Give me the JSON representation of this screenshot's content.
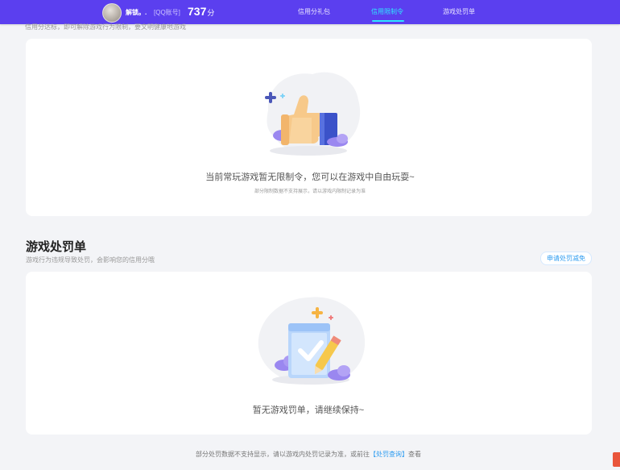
{
  "header": {
    "user_name": "解锁。.",
    "qq_label": "[QQ账号]",
    "score_value": "737",
    "score_unit": "分",
    "tabs": [
      {
        "label": "信用分礼包",
        "active": false
      },
      {
        "label": "信用限制令",
        "active": true
      },
      {
        "label": "游戏处罚单",
        "active": false
      }
    ]
  },
  "restriction": {
    "top_text": "信用分达标，即可解除游戏行为限制，要文明健康地游戏",
    "empty_title": "当前常玩游戏暂无限制令，您可以在游戏中自由玩耍~",
    "empty_sub": "部分限制数据不支持展示，请以游戏内限制记录为准"
  },
  "penalty": {
    "title": "游戏处罚单",
    "desc": "游戏行为违规导致处罚，会影响您的信用分哦",
    "appeal_label": "申请处罚减免",
    "empty_title": "暂无游戏罚单，请继续保持~"
  },
  "footer": {
    "text_before": "部分处罚数据不支持显示，请以游戏内处罚记录为准，或前往",
    "link": "【处罚查询】",
    "text_after": "查看"
  },
  "colors": {
    "topbar": "#5b3fef",
    "active_tab": "#2ee6ff",
    "link": "#2e9cf0",
    "page_bg": "#f3f4f7"
  }
}
